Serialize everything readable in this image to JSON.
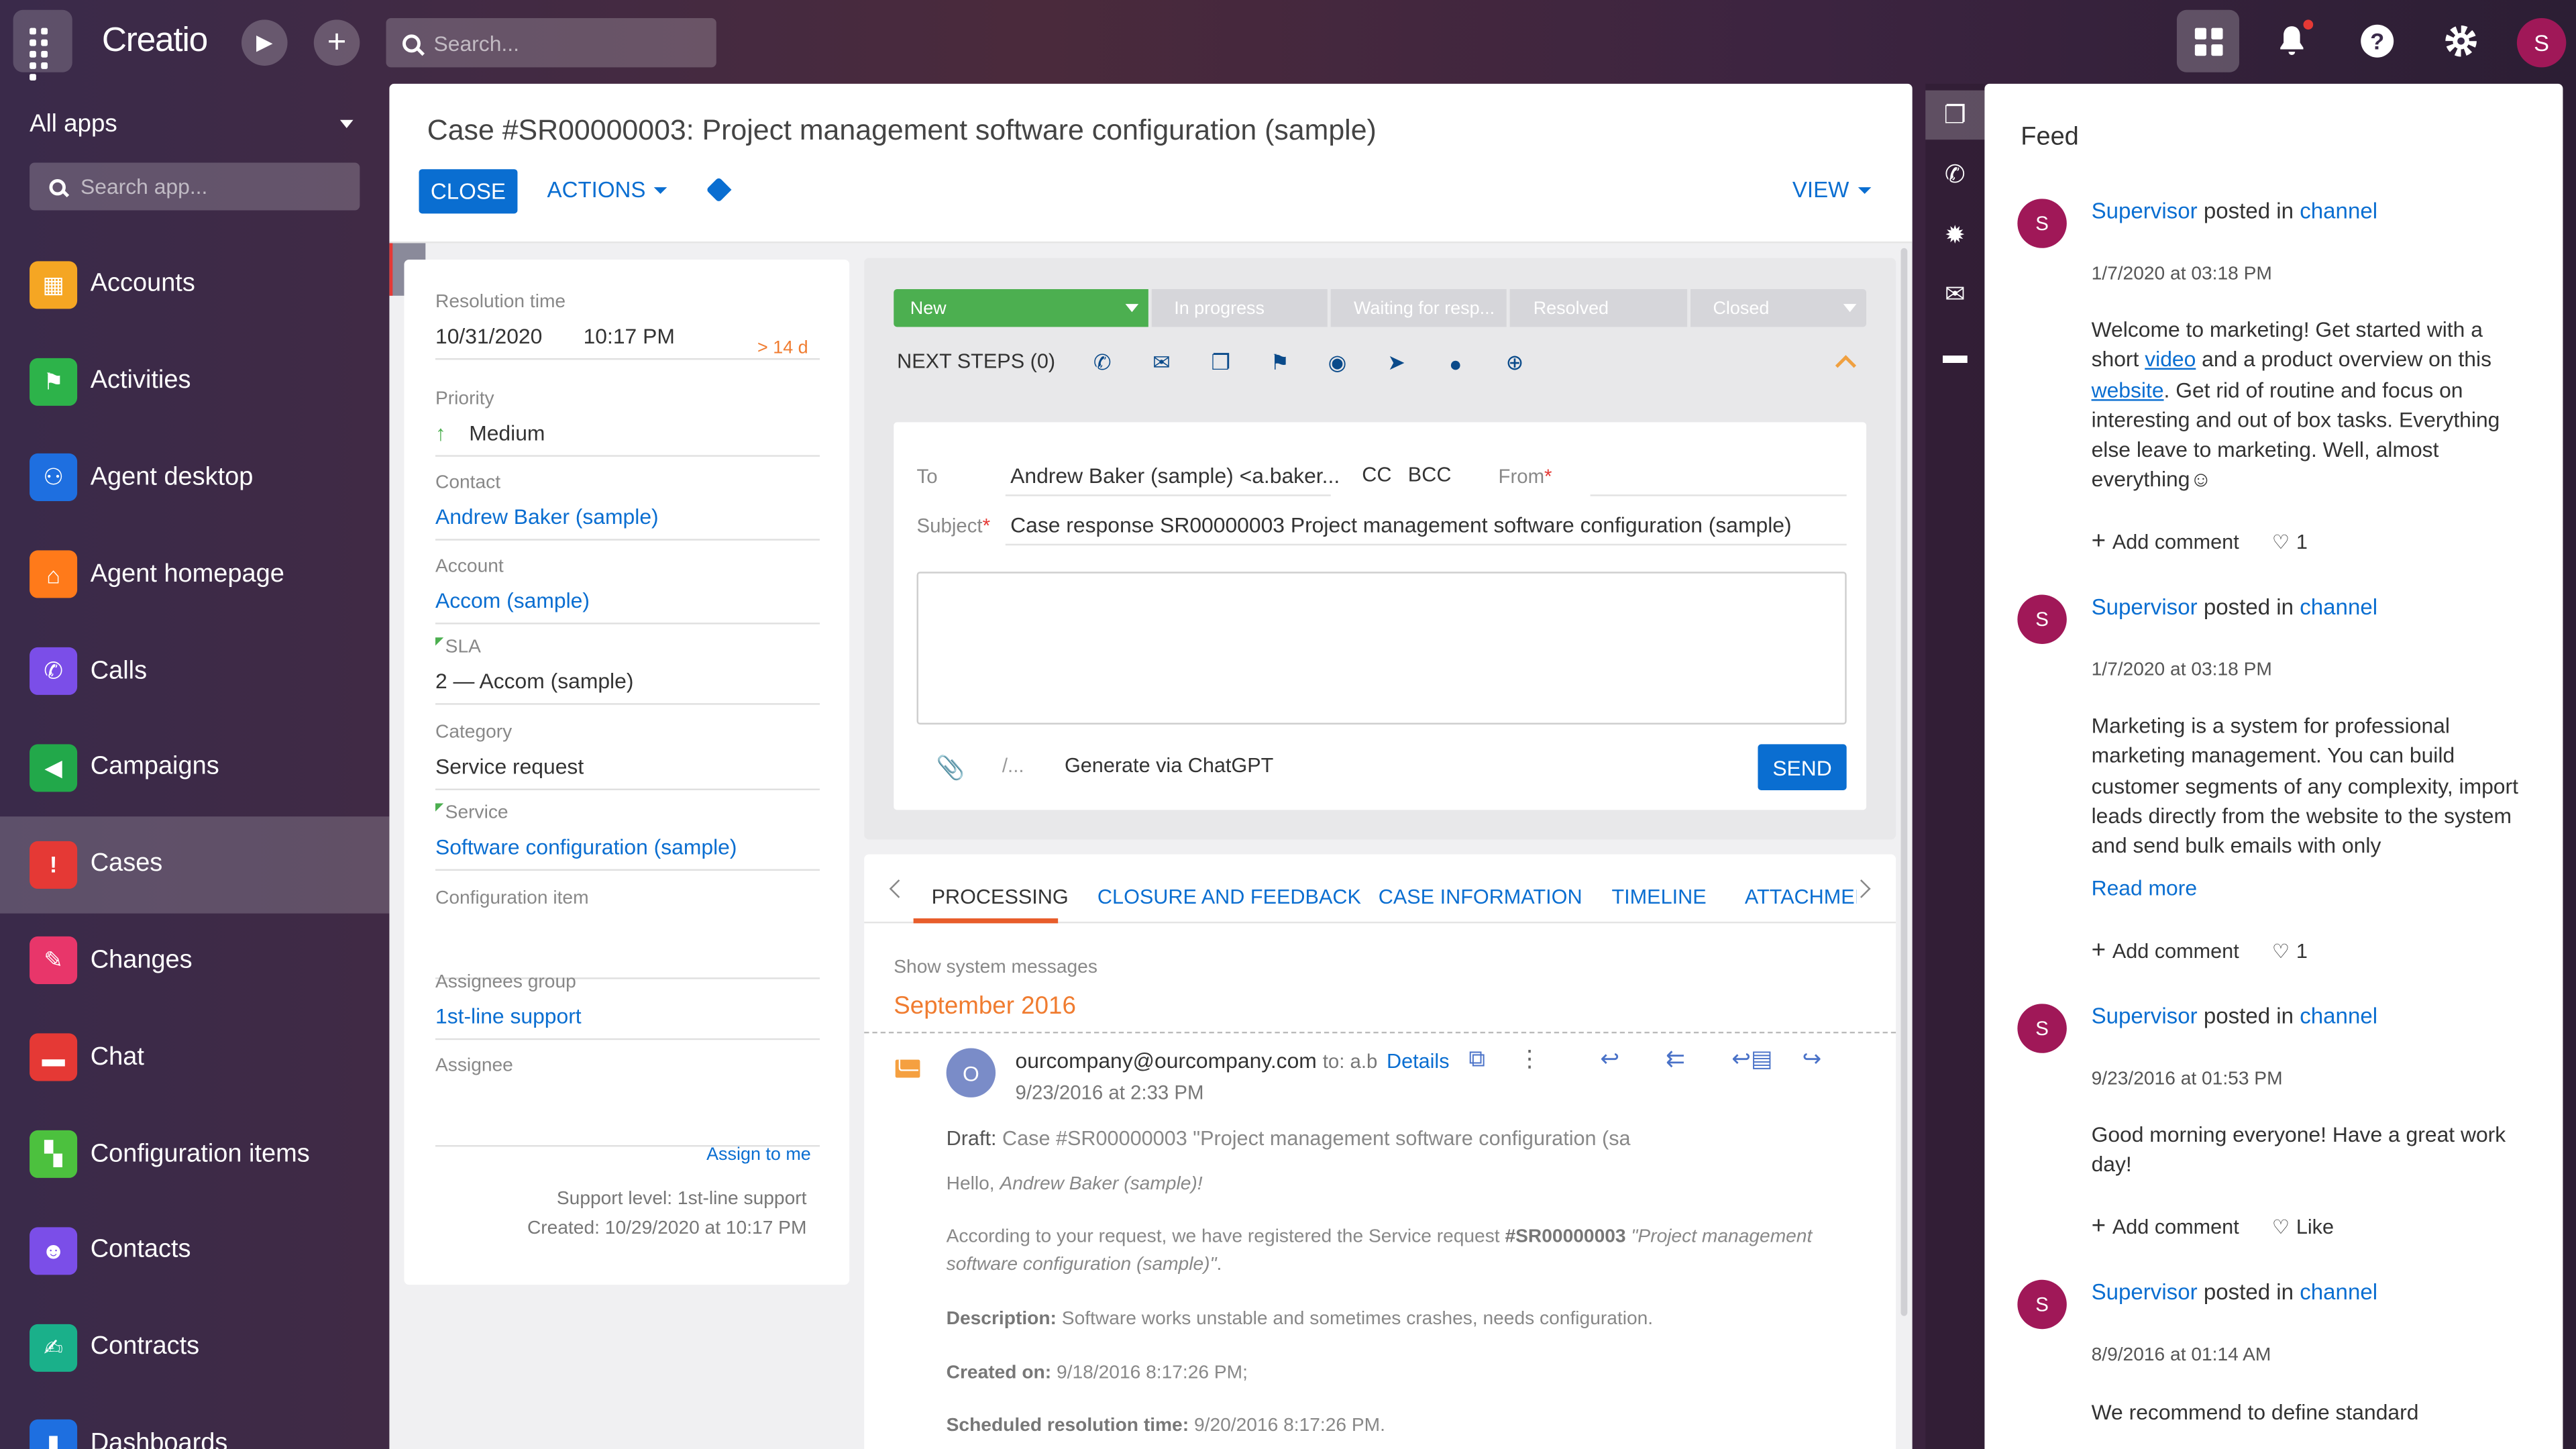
{
  "topbar": {
    "logo": "Creatio",
    "play_icon": "play-icon",
    "add_icon": "plus-icon",
    "search_placeholder": "Search...",
    "user_initial": "S"
  },
  "sidebar": {
    "all_apps": "All apps",
    "search_placeholder": "Search app...",
    "items": [
      {
        "label": "Accounts",
        "color": "#f5a623",
        "icon": "accounts-icon",
        "glyph": "▦"
      },
      {
        "label": "Activities",
        "color": "#2db34a",
        "icon": "flag-icon",
        "glyph": "⚑"
      },
      {
        "label": "Agent desktop",
        "color": "#1e6fe0",
        "icon": "agent-desktop-icon",
        "glyph": "⚇"
      },
      {
        "label": "Agent homepage",
        "color": "#ff7a1a",
        "icon": "home-icon",
        "glyph": "⌂"
      },
      {
        "label": "Calls",
        "color": "#7b4ee8",
        "icon": "phone-icon",
        "glyph": "✆"
      },
      {
        "label": "Campaigns",
        "color": "#22a84a",
        "icon": "megaphone-icon",
        "glyph": "◀"
      },
      {
        "label": "Cases",
        "color": "#e53935",
        "icon": "cases-icon",
        "glyph": "!"
      },
      {
        "label": "Changes",
        "color": "#e8366a",
        "icon": "changes-icon",
        "glyph": "✎"
      },
      {
        "label": "Chat",
        "color": "#e53935",
        "icon": "chat-icon",
        "glyph": "▬"
      },
      {
        "label": "Configuration items",
        "color": "#4cc13e",
        "icon": "configuration-icon",
        "glyph": "▚"
      },
      {
        "label": "Contacts",
        "color": "#7b4ee8",
        "icon": "contact-icon",
        "glyph": "☻"
      },
      {
        "label": "Contracts",
        "color": "#1ab08a",
        "icon": "contract-icon",
        "glyph": "✍"
      },
      {
        "label": "Dashboards",
        "color": "#1e6fe0",
        "icon": "dashboard-icon",
        "glyph": "▮"
      }
    ]
  },
  "case": {
    "title": "Case #SR00000003: Project management software configuration (sample)",
    "close_label": "CLOSE",
    "actions_label": "ACTIONS",
    "view_label": "VIEW"
  },
  "info": {
    "resolution_label": "Resolution time",
    "resolution_date": "10/31/2020",
    "resolution_time": "10:17 PM",
    "overdue": "> 14 d",
    "priority_label": "Priority",
    "priority_value": "Medium",
    "contact_label": "Contact",
    "contact_value": "Andrew Baker (sample)",
    "account_label": "Account",
    "account_value": "Accom (sample)",
    "sla_label": "SLA",
    "sla_value": "2 — Accom (sample)",
    "category_label": "Category",
    "category_value": "Service request",
    "service_label": "Service",
    "service_value": "Software configuration (sample)",
    "config_label": "Configuration item",
    "config_value": "",
    "group_label": "Assignees group",
    "group_value": "1st-line support",
    "assignee_label": "Assignee",
    "assignee_value": "",
    "assign_me": "Assign to me",
    "support_level": "Support level: 1st-line support",
    "created": "Created: 10/29/2020 at 10:17 PM"
  },
  "stages": [
    "New",
    "In progress",
    "Waiting for resp...",
    "Resolved",
    "Closed"
  ],
  "next_steps": "NEXT STEPS (0)",
  "email": {
    "to_label": "To",
    "to_value": "Andrew Baker (sample) <a.baker...",
    "cc": "CC",
    "bcc": "BCC",
    "from_label": "From",
    "subject_label": "Subject",
    "subject_value": "Case response SR00000003 Project management software configuration (sample)",
    "signature": "/...",
    "generate": "Generate via ChatGPT",
    "send": "SEND"
  },
  "tabs": [
    "PROCESSING",
    "CLOSURE AND FEEDBACK",
    "CASE INFORMATION",
    "TIMELINE",
    "ATTACHMEN"
  ],
  "timeline": {
    "show_system": "Show system messages",
    "month": "September 2016",
    "avatar": "O",
    "from": "ourcompany@ourcompany.com",
    "to": "to: a.b",
    "details": "Details",
    "date": "9/23/2016 at 2:33 PM",
    "draft_label": "Draft:",
    "draft_text": "Case #SR00000003 \"Project management software configuration (sa",
    "hello": "Hello, ",
    "hello_name": "Andrew Baker (sample)!",
    "request_pre": "According to your request, we have registered the Service request ",
    "request_id": "#SR00000003",
    "request_name": "\"Project management software configuration (sample)\"",
    "request_end": ".",
    "desc_label": "Description:",
    "desc_text": "Software works unstable and sometimes crashes, needs configuration.",
    "created_label": "Created on:",
    "created_text": "9/18/2016 8:17:26 PM;",
    "sched_label": "Scheduled resolution time:",
    "sched_text": "9/20/2016 8:17:26 PM."
  },
  "feed": {
    "title": "Feed",
    "posts": [
      {
        "author": "Supervisor",
        "posted_in": "posted in",
        "channel": "channel",
        "avatar": "S",
        "date": "1/7/2020 at 03:18 PM",
        "text_1": "Welcome to marketing! Get started with a short ",
        "link_1": "video",
        "text_2": " and a product overview on this ",
        "link_2": "website",
        "text_3": ". Get rid of routine and focus on interesting and out of box tasks. Everything else leave to marketing. Well, almost everything☺",
        "comment": "Add comment",
        "likes": "1"
      },
      {
        "author": "Supervisor",
        "posted_in": "posted in",
        "channel": "channel",
        "avatar": "S",
        "date": "1/7/2020 at 03:18 PM",
        "text": "Marketing is a system for professional marketing management. You can build customer segments of any complexity, import leads directly from the website to the system and send bulk emails with only",
        "read_more": "Read more",
        "comment": "Add comment",
        "likes": "1"
      },
      {
        "author": "Supervisor",
        "posted_in": "posted in",
        "channel": "channel",
        "avatar": "S",
        "date": "9/23/2016 at 01:53 PM",
        "text": "Good morning everyone! Have a great work day!",
        "comment": "Add comment",
        "likes": "Like"
      },
      {
        "author": "Supervisor",
        "posted_in": "posted in",
        "channel": "channel",
        "avatar": "S",
        "date": "8/9/2016 at 01:14 AM",
        "text": "We recommend to define standard"
      }
    ]
  }
}
